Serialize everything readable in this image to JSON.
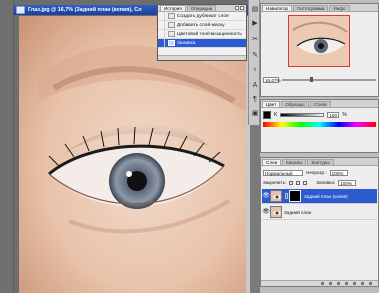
{
  "document": {
    "title": "Глаз.jpg @ 16,7% (Задний план (копия), Сл"
  },
  "history": {
    "tabs": [
      "История",
      "Операции"
    ],
    "items": [
      {
        "label": "Создать дубликат слоя",
        "selected": false
      },
      {
        "label": "Добавить слой-маску",
        "selected": false
      },
      {
        "label": "Цветовой тон/Насыщенность",
        "selected": false
      },
      {
        "label": "Заливка",
        "selected": true
      }
    ]
  },
  "navigator": {
    "tabs": [
      "Навигатор",
      "Гистограмма",
      "Инфо"
    ],
    "zoom": "16,67%"
  },
  "color": {
    "tabs": [
      "Цвет",
      "Образцы",
      "Стили"
    ],
    "channel_label": "K",
    "value": "100",
    "unit": "%"
  },
  "layers": {
    "tabs": [
      "Слои",
      "Каналы",
      "Контуры"
    ],
    "blend_mode": "Нормальный",
    "opacity_label": "Непрозр.:",
    "opacity_value": "100%",
    "lock_label": "Закрепить:",
    "fill_label": "Заливка:",
    "fill_value": "100%",
    "items": [
      {
        "name": "Задний план (копия)",
        "selected": true,
        "has_mask": true
      },
      {
        "name": "Задний план",
        "selected": false,
        "has_mask": false
      }
    ]
  },
  "colors": {
    "title_blue": "#1a3f99",
    "selection_blue": "#2b5ad1",
    "nav_frame": "#d43a3a"
  },
  "icons": [
    "history-icon",
    "brush-icon",
    "clone-icon",
    "text-icon",
    "layers-icon",
    "eye-icon",
    "chain-icon"
  ]
}
